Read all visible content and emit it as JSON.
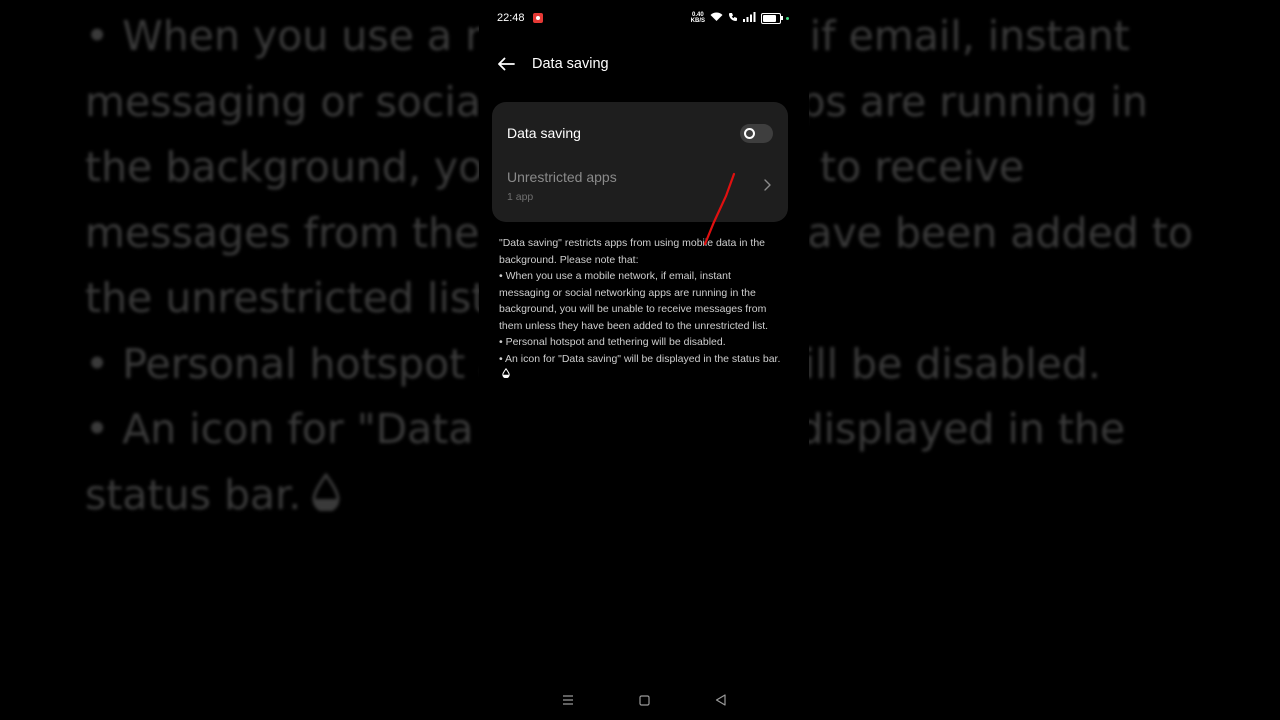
{
  "background_text": {
    "lines": [
      "• When you use a mobile network, if email, instant messaging or social networking apps are running in the background, you will be unable to receive messages from them unless they have been added to the unrestricted list.",
      "• Personal hotspot and tethering will be disabled.",
      "• An icon for \"Data saving\" will be displayed in the status bar."
    ]
  },
  "status_bar": {
    "time": "22:48",
    "speed_value": "0.40",
    "speed_unit": "KB/S",
    "icons": [
      "screen-record-icon",
      "wifi-icon",
      "call-icon",
      "signal-icon",
      "battery-icon"
    ],
    "battery_level": 0.85
  },
  "header": {
    "title": "Data saving"
  },
  "settings": {
    "data_saving": {
      "label": "Data saving",
      "enabled": false
    },
    "unrestricted_apps": {
      "label": "Unrestricted apps",
      "sub": "1 app"
    }
  },
  "description": {
    "intro": "\"Data saving\" restricts apps from using mobile data in the background. Please note that:",
    "bullet1": "• When you use a mobile network, if email, instant messaging or social networking apps are running in the background, you will be unable to receive messages from them unless they have been added to the unrestricted list.",
    "bullet2": "• Personal hotspot and tethering will be disabled.",
    "bullet3": "• An icon for \"Data saving\" will be displayed in the status bar."
  },
  "nav_bar": {
    "icons": [
      "menu-icon",
      "home-icon",
      "back-triangle-icon"
    ]
  },
  "colors": {
    "background": "#000000",
    "card": "#1e1e1e",
    "annotation": "#e01010",
    "accent_green": "#3ddc84"
  }
}
